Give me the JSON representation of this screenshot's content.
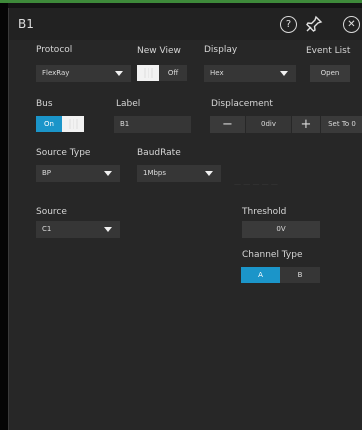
{
  "title": "B1",
  "icons": {
    "help": "help-circle-icon",
    "pin": "pin-icon",
    "close": "close-circle-icon"
  },
  "protocol": {
    "label": "Protocol",
    "value": "FlexRay"
  },
  "new_view": {
    "label": "New View",
    "state": "Off"
  },
  "display": {
    "label": "Display",
    "value": "Hex"
  },
  "event_list": {
    "label": "Event List",
    "button": "Open"
  },
  "bus": {
    "label": "Bus",
    "state": "On"
  },
  "bus_label": {
    "label": "Label",
    "value": "B1"
  },
  "displacement": {
    "label": "Displacement",
    "value": "0div",
    "minus": "−",
    "plus": "+",
    "set_to": "Set To 0"
  },
  "source_type": {
    "label": "Source Type",
    "value": "BP"
  },
  "baud_rate": {
    "label": "BaudRate",
    "value": "1Mbps"
  },
  "source": {
    "label": "Source",
    "value": "C1"
  },
  "threshold": {
    "label": "Threshold",
    "value": "0V"
  },
  "channel_type": {
    "label": "Channel Type",
    "options": [
      "A",
      "B"
    ],
    "selected": "A"
  },
  "colors": {
    "accent": "#1b95c9",
    "title_bar": "#222222",
    "panel": "#272727",
    "control": "#363636",
    "top_line": "#3e8a3a"
  }
}
